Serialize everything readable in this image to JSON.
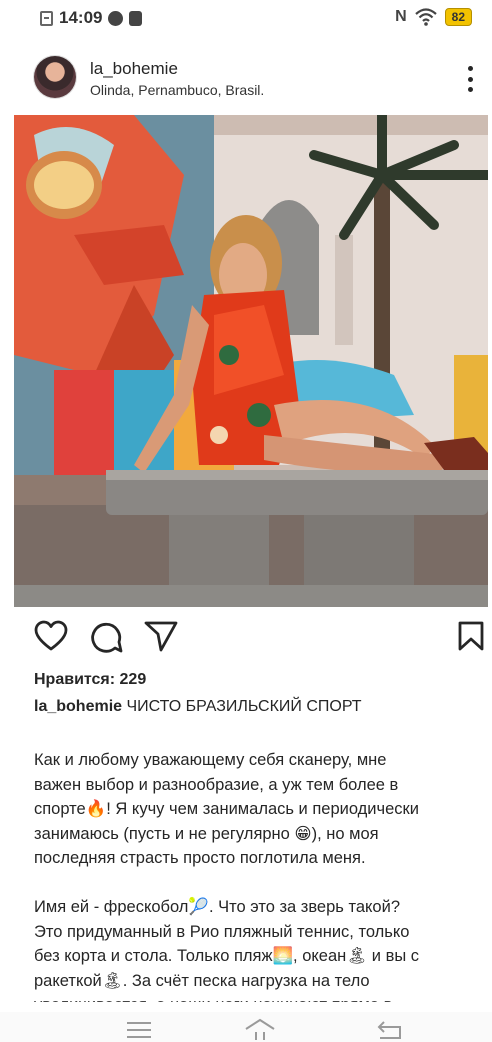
{
  "status_bar": {
    "time": "14:09",
    "network_label": "N",
    "battery_level": "82",
    "icons": [
      "notification-box-icon",
      "vpn-icon",
      "shield-icon",
      "nfc-icon",
      "wifi-icon",
      "battery-icon"
    ]
  },
  "post": {
    "username": "la_bohemie",
    "location": "Olinda, Pernambuco, Brasil.",
    "likes_text": "Нравится: 229",
    "caption_title": "ЧИСТО БРАЗИЛЬСКИЙ СПОРТ",
    "paragraph1": [
      "Как и любому уважающему себя сканеру, мне",
      "важен выбор и разнообразие, а уж тем более в",
      "спорте🔥! Я кучу чем занималась и периодически",
      "занимаюсь (пусть и не регулярно 😁), но моя",
      "последняя страсть просто поглотила меня."
    ],
    "paragraph2": [
      "Имя ей - фрескобол🎾. Что это за зверь такой?",
      "Это придуманный в Рио пляжный теннис, только",
      "без корта и стола. Только пляж🌅, океан🏝 и вы с",
      "ракеткой🏝. За счёт песка нагрузка на тело",
      "увеличивается, а наши ноги начинают прямо в"
    ]
  },
  "colors": {
    "text": "#262626",
    "dress": "#e03a1a",
    "battery": "#f2c200"
  }
}
